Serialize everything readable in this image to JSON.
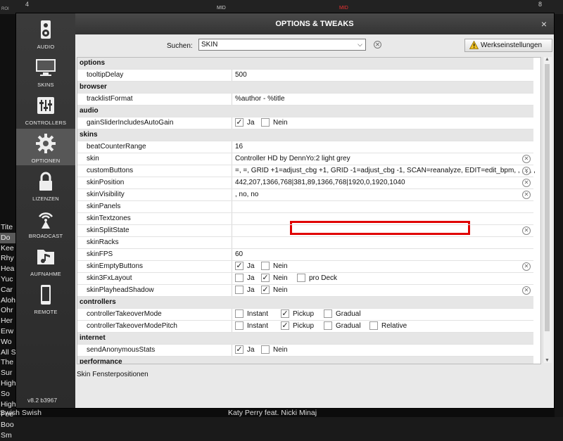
{
  "background": {
    "top_labels": [
      "4",
      "MID",
      "MID",
      "8",
      "ROI"
    ],
    "tracklist": [
      "Tite",
      "Do",
      "Kee",
      "Rhy",
      "Hea",
      "Yuc",
      "Car",
      "Aloh",
      "Ohr",
      "Her",
      "Erw",
      "Wo",
      "All S",
      "The",
      "Sur",
      "High",
      "So",
      "High",
      "Fee",
      "Boo",
      "Sm"
    ],
    "bottom_left": "Swish Swish",
    "bottom_right": "Katy Perry feat. Nicki Minaj"
  },
  "dialog": {
    "title": "OPTIONS & TWEAKS",
    "close_glyph": "×"
  },
  "sidebar": {
    "items": [
      {
        "label": "AUDIO",
        "icon": "speaker-icon"
      },
      {
        "label": "SKINS",
        "icon": "monitor-icon"
      },
      {
        "label": "CONTROLLERS",
        "icon": "sliders-icon"
      },
      {
        "label": "OPTIONEN",
        "icon": "gear-icon",
        "active": true
      },
      {
        "label": "LIZENZEN",
        "icon": "lock-icon"
      },
      {
        "label": "BROADCAST",
        "icon": "broadcast-icon"
      },
      {
        "label": "AUFNAHME",
        "icon": "music-folder-icon"
      },
      {
        "label": "REMOTE",
        "icon": "phone-icon"
      }
    ],
    "version": "v8.2 b3967"
  },
  "search": {
    "label": "Suchen:",
    "value": "SKIN"
  },
  "reset_button": {
    "label": "Werkseinstellungen"
  },
  "rows": [
    {
      "type": "section",
      "name": "options"
    },
    {
      "type": "opt",
      "name": "tooltipDelay",
      "value": "500"
    },
    {
      "type": "section",
      "name": "browser"
    },
    {
      "type": "opt",
      "name": "tracklistFormat",
      "value": "%author - %title"
    },
    {
      "type": "section",
      "name": "audio"
    },
    {
      "type": "opt",
      "name": "gainSliderIncludesAutoGain",
      "checks": [
        {
          "label": "Ja",
          "checked": true
        },
        {
          "label": "Nein",
          "checked": false
        }
      ]
    },
    {
      "type": "section",
      "name": "skins"
    },
    {
      "type": "opt",
      "name": "beatCounterRange",
      "value": "16"
    },
    {
      "type": "opt",
      "name": "skin",
      "value": "Controller HD by DennYo:2 light grey",
      "clear": true
    },
    {
      "type": "opt",
      "name": "customButtons",
      "value": "=, =, GRID +1=adjust_cbg +1, GRID -1=adjust_cbg -1, SCAN=reanalyze, EDIT=edit_bpm, , , , , ,",
      "clear": true
    },
    {
      "type": "opt",
      "name": "skinPosition",
      "value": "442,207,1366,768|381,89,1366,768|1920,0,1920,1040",
      "clear": true,
      "highlight": true
    },
    {
      "type": "opt",
      "name": "skinVisibility",
      "value": ", no, no",
      "clear": true
    },
    {
      "type": "opt",
      "name": "skinPanels",
      "value": ""
    },
    {
      "type": "opt",
      "name": "skinTextzones",
      "value": ""
    },
    {
      "type": "opt",
      "name": "skinSplitState",
      "value": "",
      "clear": true
    },
    {
      "type": "opt",
      "name": "skinRacks",
      "value": ""
    },
    {
      "type": "opt",
      "name": "skinFPS",
      "value": "60"
    },
    {
      "type": "opt",
      "name": "skinEmptyButtons",
      "checks": [
        {
          "label": "Ja",
          "checked": true
        },
        {
          "label": "Nein",
          "checked": false
        }
      ],
      "clear": true
    },
    {
      "type": "opt",
      "name": "skin3FxLayout",
      "checks": [
        {
          "label": "Ja",
          "checked": false
        },
        {
          "label": "Nein",
          "checked": true
        },
        {
          "label": "pro Deck",
          "checked": false
        }
      ]
    },
    {
      "type": "opt",
      "name": "skinPlayheadShadow",
      "checks": [
        {
          "label": "Ja",
          "checked": false
        },
        {
          "label": "Nein",
          "checked": true
        }
      ],
      "clear": true
    },
    {
      "type": "section",
      "name": "controllers"
    },
    {
      "type": "opt",
      "name": "controllerTakeoverMode",
      "checks": [
        {
          "label": "Instant",
          "checked": false
        },
        {
          "label": "Pickup",
          "checked": true
        },
        {
          "label": "Gradual",
          "checked": false
        }
      ]
    },
    {
      "type": "opt",
      "name": "controllerTakeoverModePitch",
      "checks": [
        {
          "label": "Instant",
          "checked": false
        },
        {
          "label": "Pickup",
          "checked": true
        },
        {
          "label": "Gradual",
          "checked": false
        },
        {
          "label": "Relative",
          "checked": false
        }
      ]
    },
    {
      "type": "section",
      "name": "internet"
    },
    {
      "type": "opt",
      "name": "sendAnonymousStats",
      "checks": [
        {
          "label": "Ja",
          "checked": true
        },
        {
          "label": "Nein",
          "checked": false
        }
      ]
    },
    {
      "type": "section",
      "name": "performance"
    }
  ],
  "status_text": "Skin Fensterpositionen",
  "colors": {
    "highlight": "#e00000",
    "sidebar_active": "#575757",
    "warning": "#f0c020"
  }
}
